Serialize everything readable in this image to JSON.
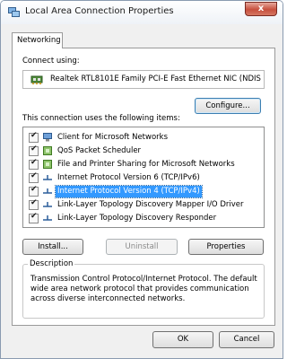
{
  "window": {
    "title": "Local Area Connection Properties",
    "close_glyph": "x"
  },
  "tabs": [
    {
      "label": "Networking",
      "active": true
    }
  ],
  "connect_using": {
    "label": "Connect using:",
    "adapter": "Realtek RTL8101E Family PCI-E Fast Ethernet NIC (NDIS",
    "configure_button": "Configure..."
  },
  "items_section": {
    "label": "This connection uses the following items:",
    "items": [
      {
        "label": "Client for Microsoft Networks",
        "checked": true,
        "selected": false,
        "icon": "network-client-icon"
      },
      {
        "label": "QoS Packet Scheduler",
        "checked": true,
        "selected": false,
        "icon": "network-service-icon"
      },
      {
        "label": "File and Printer Sharing for Microsoft Networks",
        "checked": true,
        "selected": false,
        "icon": "network-service-icon"
      },
      {
        "label": "Internet Protocol Version 6 (TCP/IPv6)",
        "checked": true,
        "selected": false,
        "icon": "protocol-icon"
      },
      {
        "label": "Internet Protocol Version 4 (TCP/IPv4)",
        "checked": true,
        "selected": true,
        "icon": "protocol-icon"
      },
      {
        "label": "Link-Layer Topology Discovery Mapper I/O Driver",
        "checked": true,
        "selected": false,
        "icon": "protocol-icon"
      },
      {
        "label": "Link-Layer Topology Discovery Responder",
        "checked": true,
        "selected": false,
        "icon": "protocol-icon"
      }
    ]
  },
  "actions": {
    "install": "Install...",
    "uninstall": "Uninstall",
    "properties": "Properties"
  },
  "description": {
    "title": "Description",
    "lines": [
      "Transmission Control Protocol/Internet Protocol. The default",
      "wide area network protocol that provides communication",
      "across diverse interconnected networks."
    ]
  },
  "footer": {
    "ok": "OK",
    "cancel": "Cancel"
  },
  "colors": {
    "selection": "#3399ff",
    "close_button": "#c7503e",
    "window_bg": "#f0f0f0"
  }
}
